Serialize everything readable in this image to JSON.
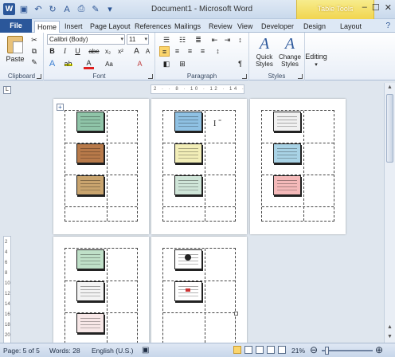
{
  "window": {
    "title": "Document1 - Microsoft Word",
    "contextual_group": "Table Tools",
    "controls": [
      "–",
      "☐",
      "✕"
    ]
  },
  "tabs": [
    "File",
    "Home",
    "Insert",
    "Page Layout",
    "References",
    "Mailings",
    "Review",
    "View",
    "Developer",
    "Design",
    "Layout"
  ],
  "active_tab": "Home",
  "ribbon": {
    "clipboard": {
      "label": "Clipboard",
      "paste": "Paste"
    },
    "font": {
      "label": "Font",
      "font_name": "Calibri (Body)",
      "font_size": "11",
      "bold": "B",
      "italic": "I",
      "underline": "U",
      "strike": "abe",
      "subscript": "x₂",
      "superscript": "x²",
      "grow": "A",
      "shrink": "A",
      "aa": "Aa",
      "clear": "A"
    },
    "paragraph": {
      "label": "Paragraph"
    },
    "styles": {
      "label": "Styles",
      "quick_styles": "Quick Styles",
      "change_styles": "Change Styles"
    },
    "editing": {
      "label": "Editing",
      "button": "Editing"
    }
  },
  "ruler_marks": "2 · · 8 · 10 · 12 · 14 · 16 · 18",
  "vruler_marks": [
    "2",
    "4",
    "6",
    "8",
    "10",
    "12",
    "14",
    "16",
    "18",
    "20"
  ],
  "status": {
    "page": "Page: 5 of 5",
    "words": "Words: 28",
    "language": "English (U.S.)",
    "zoom": "21%",
    "zoom_value_percent": 21
  },
  "thumb_colors": [
    "#8fc4a8",
    "#b87a4a",
    "#c9a46e",
    "#8fc1e3",
    "#f2eeb8",
    "#cfe5d8",
    "#f1f1f1",
    "#a9d3e6",
    "#f4b9b9",
    "#bfe0c8",
    "#f3f3f3",
    "#f7e7e7"
  ]
}
